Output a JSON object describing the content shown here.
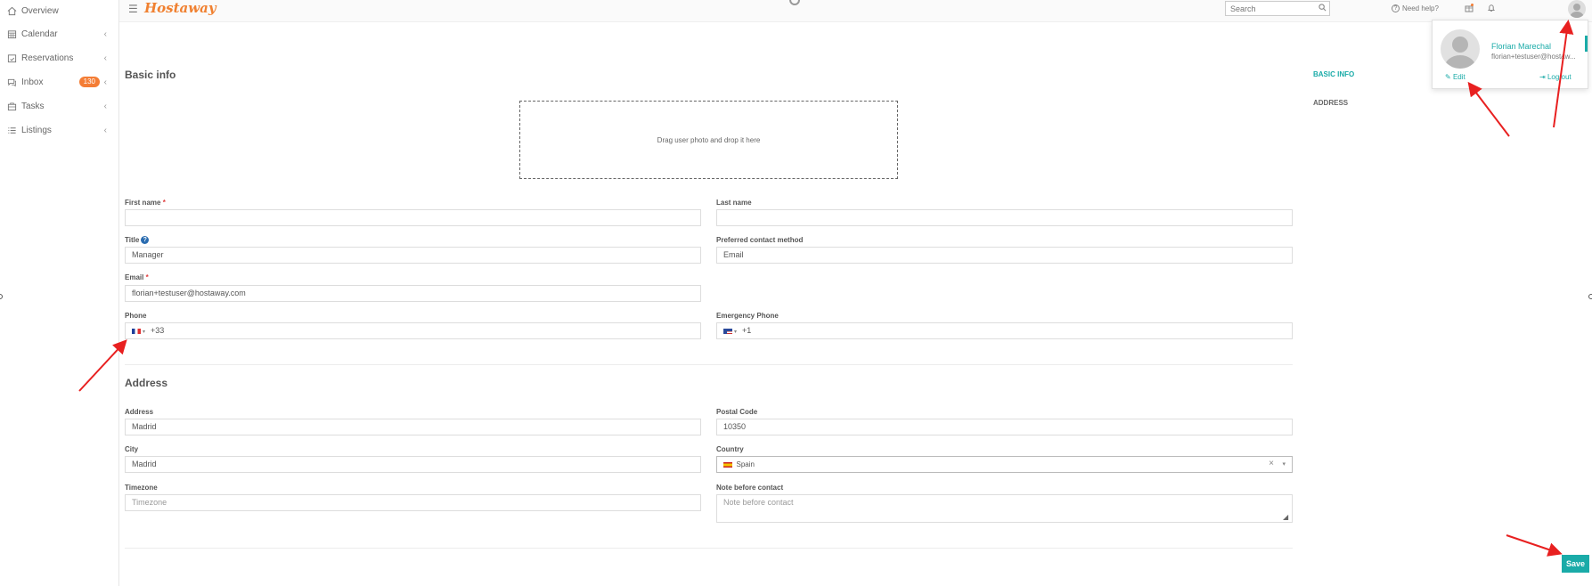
{
  "sidebar": {
    "items": [
      {
        "label": "Overview",
        "icon": "home-icon",
        "chevron": false
      },
      {
        "label": "Calendar",
        "icon": "calendar-icon",
        "chevron": true
      },
      {
        "label": "Reservations",
        "icon": "reservations-icon",
        "chevron": true
      },
      {
        "label": "Inbox",
        "icon": "inbox-icon",
        "chevron": true,
        "badge": "130"
      },
      {
        "label": "Tasks",
        "icon": "tasks-icon",
        "chevron": true
      },
      {
        "label": "Listings",
        "icon": "listings-icon",
        "chevron": true
      }
    ]
  },
  "topbar": {
    "logo": "Hostaway",
    "search_placeholder": "Search",
    "help_label": "Need help?"
  },
  "profile": {
    "name": "Florian Marechal",
    "email": "florian+testuser@hostaw...",
    "edit_label": "Edit",
    "logout_label": "Log out"
  },
  "right_nav": {
    "basic_info": "BASIC INFO",
    "address": "ADDRESS"
  },
  "form": {
    "basic_info_title": "Basic info",
    "dropzone_text": "Drag user photo and drop it here",
    "first_name_label": "First name",
    "first_name_value": "",
    "last_name_label": "Last name",
    "last_name_value": "",
    "title_label": "Title",
    "title_value": "Manager",
    "preferred_contact_label": "Preferred contact method",
    "preferred_contact_value": "Email",
    "email_label": "Email",
    "email_value": "florian+testuser@hostaway.com",
    "phone_label": "Phone",
    "phone_code": "+33",
    "emergency_phone_label": "Emergency Phone",
    "emergency_phone_code": "+1",
    "address_title": "Address",
    "address_label": "Address",
    "address_value": "Madrid",
    "postal_code_label": "Postal Code",
    "postal_code_value": "10350",
    "city_label": "City",
    "city_value": "Madrid",
    "country_label": "Country",
    "country_value": "Spain",
    "timezone_label": "Timezone",
    "timezone_placeholder": "Timezone",
    "note_label": "Note before contact",
    "note_placeholder": "Note before contact",
    "required_mark": "*",
    "save_label": "Save"
  },
  "colors": {
    "accent": "#1aaba8",
    "brand": "#f08030",
    "badge": "#f47d35",
    "annotation_arrow": "#e82020"
  }
}
